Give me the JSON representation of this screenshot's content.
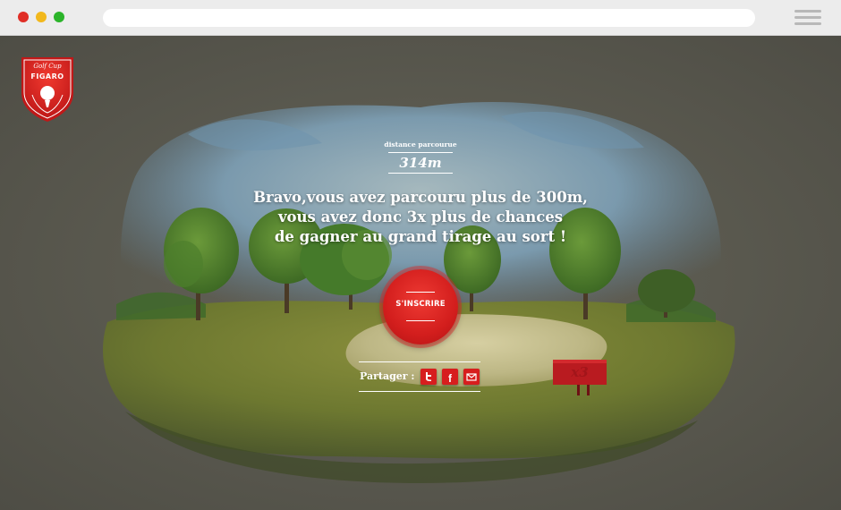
{
  "browser": {
    "window_controls": [
      "close",
      "minimize",
      "maximize"
    ],
    "menu_icon": "hamburger-icon"
  },
  "logo": {
    "line1": "Golf Cup",
    "line2": "FIGARO",
    "icon": "golf-ball-tee-icon"
  },
  "distance": {
    "label": "distance parcourue",
    "value": "314m"
  },
  "message": {
    "line1": "Bravo,vous avez parcouru plus de 300m,",
    "line2": "vous avez donc 3x plus de chances",
    "line3": "de gagner au grand tirage au sort !"
  },
  "signup_button": {
    "label": "S'INSCRIRE"
  },
  "share": {
    "label": "Partager :",
    "buttons": [
      {
        "name": "twitter",
        "icon": "twitter-icon"
      },
      {
        "name": "facebook",
        "icon": "facebook-icon",
        "glyph": "f"
      },
      {
        "name": "email",
        "icon": "mail-icon"
      }
    ]
  },
  "multiplier_sign": {
    "label": "x3"
  },
  "colors": {
    "accent_red": "#d31e1d",
    "background": "#5a594f",
    "sky": "#7ea1b5",
    "grass": "#6f7d32"
  }
}
